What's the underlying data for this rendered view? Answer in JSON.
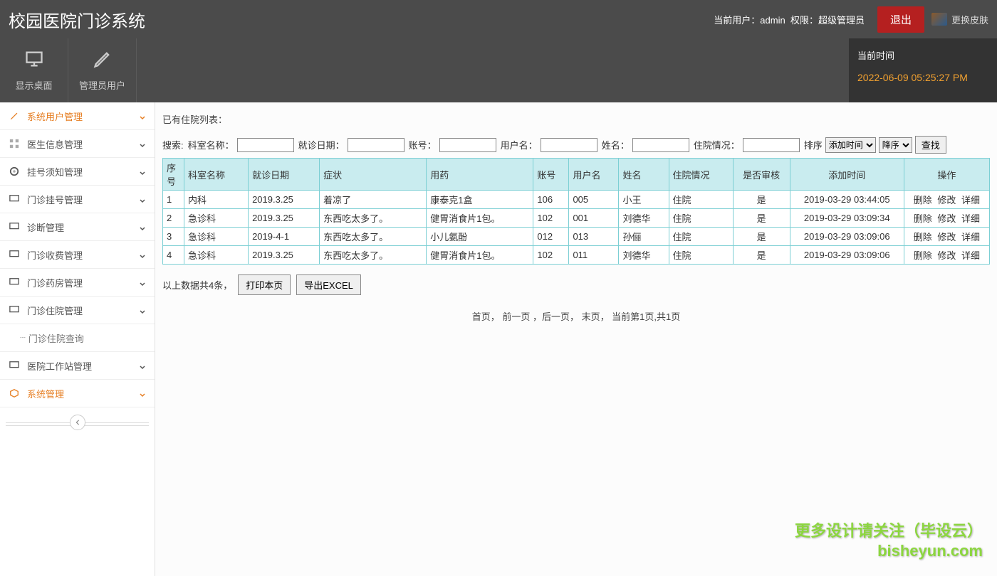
{
  "header": {
    "title": "校园医院门诊系统",
    "user_label": "当前用户：",
    "user_name": "admin",
    "role_label": "权限：",
    "role_name": "超级管理员",
    "logout": "退出",
    "skin": "更换皮肤"
  },
  "toolbar": {
    "desktop": "显示桌面",
    "admin_users": "管理员用户"
  },
  "clock": {
    "label": "当前时间",
    "value": "2022-06-09 05:25:27 PM"
  },
  "sidebar": {
    "items": [
      {
        "label": "系统用户管理",
        "icon": "pencil",
        "active": true
      },
      {
        "label": "医生信息管理",
        "icon": "grid"
      },
      {
        "label": "挂号须知管理",
        "icon": "disc"
      },
      {
        "label": "门诊挂号管理",
        "icon": "monitor"
      },
      {
        "label": "诊断管理",
        "icon": "monitor"
      },
      {
        "label": "门诊收费管理",
        "icon": "monitor"
      },
      {
        "label": "门诊药房管理",
        "icon": "monitor"
      },
      {
        "label": "门诊住院管理",
        "icon": "monitor"
      },
      {
        "label": "医院工作站管理",
        "icon": "monitor"
      },
      {
        "label": "系统管理",
        "icon": "box",
        "active": true
      }
    ],
    "subitem": "门诊住院查询"
  },
  "content": {
    "list_title": "已有住院列表：",
    "search": {
      "label": "搜索:",
      "dept_label": "科室名称：",
      "visit_date_label": "就诊日期：",
      "account_label": "账号：",
      "username_label": "用户名：",
      "name_label": "姓名：",
      "hosp_label": "住院情况：",
      "sort_label": "排序",
      "sort_field": "添加时间",
      "sort_order": "降序",
      "find_btn": "查找"
    },
    "columns": [
      "序号",
      "科室名称",
      "就诊日期",
      "症状",
      "用药",
      "账号",
      "用户名",
      "姓名",
      "住院情况",
      "是否审核",
      "添加时间",
      "操作"
    ],
    "rows": [
      {
        "idx": "1",
        "dept": "内科",
        "date": "2019.3.25",
        "symptom": "着凉了",
        "medicine": "康泰克1盒",
        "account": "106",
        "username": "005",
        "name": "小王",
        "status": "住院",
        "reviewed": "是",
        "added": "2019-03-29 03:44:05"
      },
      {
        "idx": "2",
        "dept": "急诊科",
        "date": "2019.3.25",
        "symptom": "东西吃太多了。",
        "medicine": "健胃消食片1包。",
        "account": "102",
        "username": "001",
        "name": "刘德华",
        "status": "住院",
        "reviewed": "是",
        "added": "2019-03-29 03:09:34"
      },
      {
        "idx": "3",
        "dept": "急诊科",
        "date": "2019-4-1",
        "symptom": "东西吃太多了。",
        "medicine": "小儿氨酚",
        "account": "012",
        "username": "013",
        "name": "孙俪",
        "status": "住院",
        "reviewed": "是",
        "added": "2019-03-29 03:09:06"
      },
      {
        "idx": "4",
        "dept": "急诊科",
        "date": "2019.3.25",
        "symptom": "东西吃太多了。",
        "medicine": "健胃消食片1包。",
        "account": "102",
        "username": "011",
        "name": "刘德华",
        "status": "住院",
        "reviewed": "是",
        "added": "2019-03-29 03:09:06"
      }
    ],
    "actions": {
      "del": "删除",
      "edit": "修改",
      "detail": "详细"
    },
    "summary": "以上数据共4条，",
    "print_btn": "打印本页",
    "export_btn": "导出EXCEL",
    "pagination": "首页， 前一页 ，后一页， 末页， 当前第1页,共1页"
  },
  "watermark": {
    "line1": "更多设计请关注（毕设云）",
    "line2": "bisheyun.com"
  }
}
